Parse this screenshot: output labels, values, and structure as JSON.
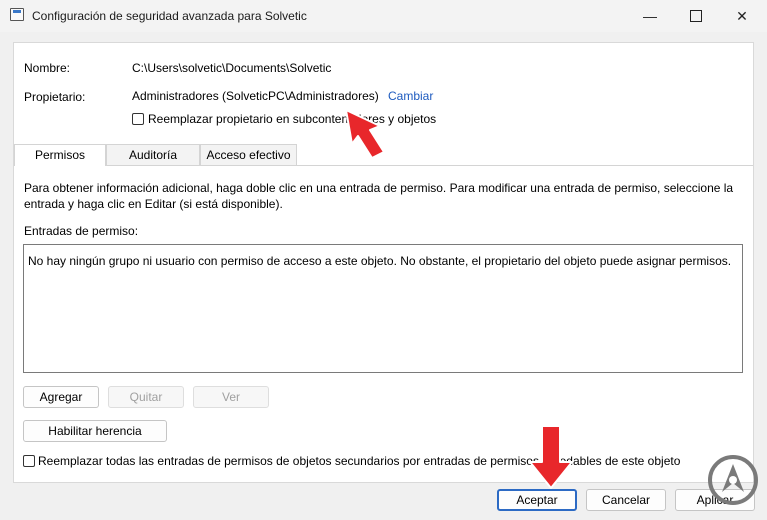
{
  "window": {
    "title": "Configuración de seguridad avanzada para Solvetic",
    "minimize_glyph": "—",
    "close_glyph": "✕"
  },
  "header": {
    "name_label": "Nombre:",
    "name_value": "C:\\Users\\solvetic\\Documents\\Solvetic",
    "owner_label": "Propietario:",
    "owner_value": "Administradores (SolveticPC\\Administradores)",
    "change_link": "Cambiar",
    "replace_owner_checkbox": {
      "label": "Reemplazar propietario en subcontenedores y objetos",
      "checked": false
    }
  },
  "tabs": [
    {
      "label": "Permisos",
      "active": true
    },
    {
      "label": "Auditoría",
      "active": false
    },
    {
      "label": "Acceso efectivo",
      "active": false
    }
  ],
  "permissions": {
    "info_line1": "Para obtener información adicional, haga doble clic en una entrada de permiso. Para modificar una entrada de permiso, seleccione la",
    "info_line2": "entrada y haga clic en Editar (si está disponible).",
    "entries_label": "Entradas de permiso:",
    "empty_message": "No hay ningún grupo ni usuario con permiso de acceso a este objeto. No obstante, el propietario del objeto puede asignar permisos.",
    "add_button": "Agregar",
    "remove_button": "Quitar",
    "view_button": "Ver",
    "enable_inheritance_button": "Habilitar herencia",
    "replace_child_checkbox": {
      "label": "Reemplazar todas las entradas de permisos de objetos secundarios por entradas de permisos heredables de este objeto",
      "checked": false
    }
  },
  "footer": {
    "ok_button": "Aceptar",
    "cancel_button": "Cancelar",
    "apply_button": "Aplicar"
  },
  "colors": {
    "accent": "#2c6ac4",
    "link": "#1e5bbf",
    "annotation_arrow": "#e8272b",
    "watermark": "#7a7a7a"
  }
}
